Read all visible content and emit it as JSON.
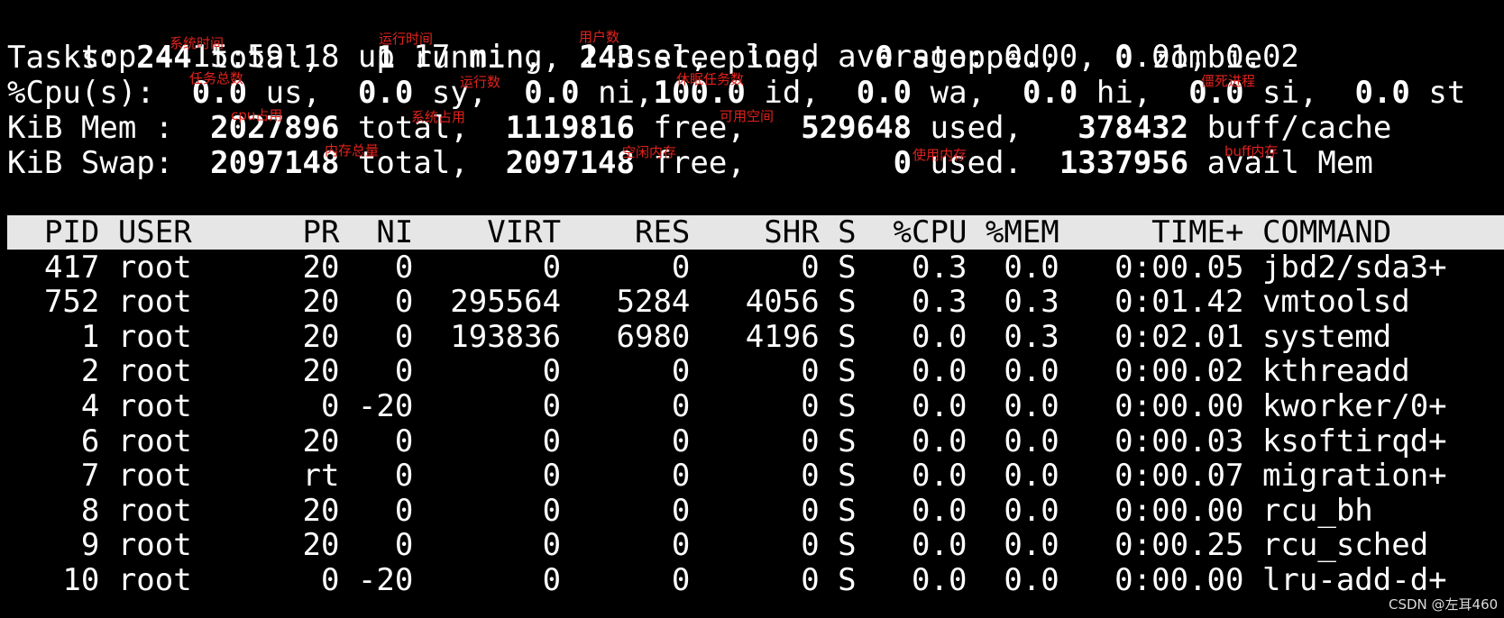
{
  "summary": {
    "l1": {
      "t": "top - 15:59:18 up 17 min,  1 user,  load average: 0.00, 0.01, 0.02"
    },
    "l2": {
      "a": "Tasks: ",
      "total": "244",
      "b": " total,   ",
      "running": "1",
      "c": " running, ",
      "sleeping": "243",
      "d": " sleeping,   ",
      "stopped": "0",
      "e": " stopped,   ",
      "zombie": "0",
      "f": " zombie"
    },
    "l3": {
      "a": "%Cpu(s):  ",
      "us": "0.0",
      "b": " us,  ",
      "sy": "0.0",
      "c": " sy,  ",
      "ni": "0.0",
      "d": " ni,",
      "id": "100.0",
      "e": " id,  ",
      "wa": "0.0",
      "f": " wa,  ",
      "hi": "0.0",
      "g": " hi,  ",
      "si": "0.0",
      "h": " si,  ",
      "st": "0.0",
      "i": " st"
    },
    "l4": {
      "a": "KiB Mem :  ",
      "total": "2027896",
      "b": " total,  ",
      "free": "1119816",
      "c": " free,   ",
      "used": "529648",
      "d": " used,   ",
      "cache": "378432",
      "e": " buff/cache"
    },
    "l5": {
      "a": "KiB Swap:  ",
      "total": "2097148",
      "b": " total,  ",
      "free": "2097148",
      "c": " free,        ",
      "used": "0",
      "d": " used.  ",
      "avail": "1337956",
      "e": " avail Mem"
    }
  },
  "table": {
    "header": "  PID USER      PR  NI    VIRT    RES    SHR S  %CPU %MEM     TIME+ COMMAND",
    "rows": [
      "  417 root      20   0       0      0      0 S   0.3  0.0   0:00.05 jbd2/sda3+",
      "  752 root      20   0  295564   5284   4056 S   0.3  0.3   0:01.42 vmtoolsd",
      "    1 root      20   0  193836   6980   4196 S   0.0  0.3   0:02.01 systemd",
      "    2 root      20   0       0      0      0 S   0.0  0.0   0:00.02 kthreadd",
      "    4 root       0 -20       0      0      0 S   0.0  0.0   0:00.00 kworker/0+",
      "    6 root      20   0       0      0      0 S   0.0  0.0   0:00.03 ksoftirqd+",
      "    7 root      rt   0       0      0      0 S   0.0  0.0   0:00.07 migration+",
      "    8 root      20   0       0      0      0 S   0.0  0.0   0:00.00 rcu_bh",
      "    9 root      20   0       0      0      0 S   0.0  0.0   0:00.25 rcu_sched",
      "   10 root       0 -20       0      0      0 S   0.0  0.0   0:00.00 lru-add-d+"
    ]
  },
  "annotations": {
    "sys_time": "系统时间",
    "run_time": "运行时间",
    "users": "用户数",
    "tasks_total": "任务总数",
    "running": "运行数",
    "sleeping": "休眠任务数",
    "zombie": "僵死进程",
    "cpu_user": "cpu占用",
    "cpu_sys": "系统占用",
    "idle": "可用空间",
    "mem_total": "内存总量",
    "mem_free": "空闲内存",
    "mem_used": "使用内存",
    "buff": "buff内存"
  },
  "watermark": "CSDN @左耳460",
  "colors": {
    "background": "#000000",
    "text": "#ffffff",
    "header_bar": "#e6e6e6",
    "annotation": "#e0221c"
  }
}
